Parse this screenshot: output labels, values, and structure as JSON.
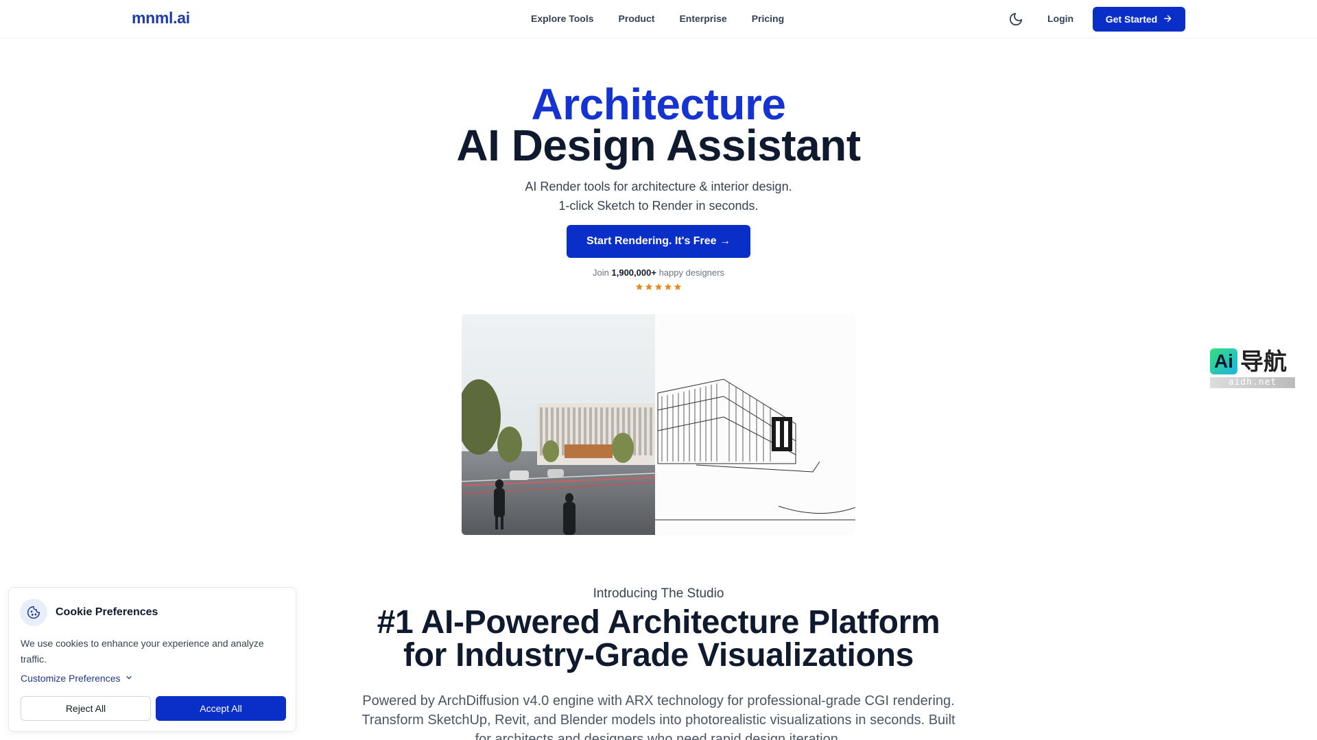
{
  "nav": {
    "logo": "mnml.ai",
    "links": [
      "Explore Tools",
      "Product",
      "Enterprise",
      "Pricing"
    ],
    "login": "Login",
    "get_started": "Get Started",
    "theme_icon": "moon-icon",
    "get_started_icon": "arrow-right-icon"
  },
  "hero": {
    "title_accent": "Architecture",
    "title_main": "AI Design Assistant",
    "subtitle_line1": "AI Render tools for architecture & interior design.",
    "subtitle_line2": "1-click Sketch to Render in seconds.",
    "cta": "Start Rendering. It's Free →",
    "join_prefix": "Join",
    "join_count": "1,900,000+",
    "join_suffix": "happy designers",
    "rating_stars": 5,
    "star_color": "#e8891c"
  },
  "watermark": {
    "ai_text": "Ai",
    "cn_text": "导航",
    "url": "aidh.net"
  },
  "studio": {
    "intro": "Introducing The Studio",
    "title_line1": "#1 AI-Powered Architecture Platform",
    "title_line2": "for Industry-Grade Visualizations",
    "description": "Powered by ArchDiffusion v4.0 engine with ARX technology for professional-grade CGI rendering. Transform SketchUp, Revit, and Blender models into photorealistic visualizations in seconds. Built for architects and designers who need rapid design iteration."
  },
  "cookie": {
    "icon": "cookie-icon",
    "title": "Cookie Preferences",
    "text": "We use cookies to enhance your experience and analyze traffic.",
    "customize": "Customize Preferences",
    "reject": "Reject All",
    "accept": "Accept All"
  },
  "colors": {
    "brand": "#0a2fc9",
    "accent_title": "#1533d1",
    "dark": "#0f1a2e"
  }
}
